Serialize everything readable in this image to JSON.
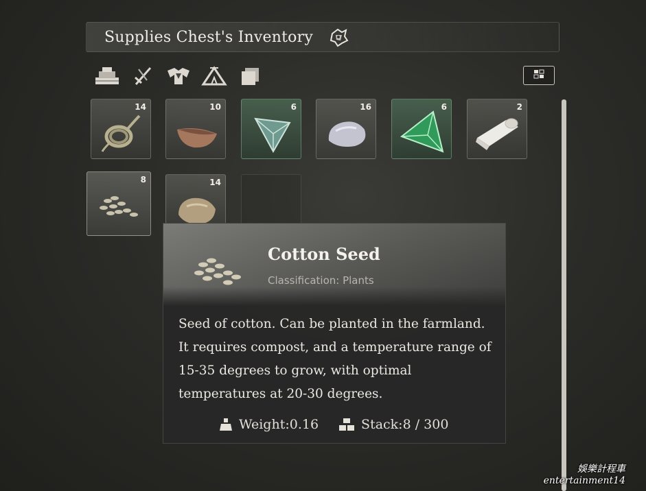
{
  "header": {
    "title": "Supplies Chest's Inventory",
    "title_icon": "chest-emblem-icon"
  },
  "filters": [
    {
      "name": "materials-filter-icon"
    },
    {
      "name": "weapons-filter-icon"
    },
    {
      "name": "armor-filter-icon"
    },
    {
      "name": "camp-filter-icon"
    },
    {
      "name": "misc-filter-icon"
    }
  ],
  "layout_toggle": {
    "icon": "grid-layout-icon"
  },
  "inventory": {
    "slots": [
      {
        "item": "rope-coil",
        "count": "14",
        "rarity": "common"
      },
      {
        "item": "wooden-bowl",
        "count": "10",
        "rarity": "common"
      },
      {
        "item": "green-tetra-crystal",
        "count": "6",
        "rarity": "uncommon"
      },
      {
        "item": "silver-ore",
        "count": "16",
        "rarity": "common"
      },
      {
        "item": "emerald-tetra-crystal",
        "count": "6",
        "rarity": "uncommon"
      },
      {
        "item": "cloth-roll",
        "count": "2",
        "rarity": "common"
      },
      {
        "item": "cotton-seed",
        "count": "8",
        "rarity": "common",
        "selected": true
      },
      {
        "item": "gold-ore",
        "count": "14",
        "rarity": "common"
      },
      {
        "item": "empty",
        "count": "",
        "rarity": "none"
      }
    ]
  },
  "tooltip": {
    "name": "Cotton Seed",
    "classification": "Classification: Plants",
    "description_lines": [
      "Seed of cotton. Can be planted in the farmland.",
      "It requires compost, and a temperature range of",
      "15-35 degrees to grow, with optimal",
      "temperatures at 20-30 degrees."
    ],
    "weight": "Weight:0.16",
    "stack": "Stack:8 / 300"
  },
  "watermark": {
    "line1": "娛樂計程車",
    "line2": "entertainment14"
  },
  "colors": {
    "background": "#2b2b28",
    "tooltip_bg": "#282828",
    "uncommon": "#4a6e55",
    "text": "#e9e6df"
  }
}
